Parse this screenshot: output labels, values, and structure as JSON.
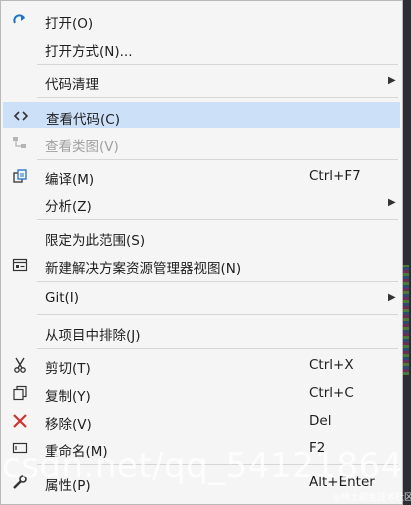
{
  "menu": {
    "items": [
      {
        "label": "打开(O)",
        "icon": "redo-arrow-icon"
      },
      {
        "label": "打开方式(N)..."
      },
      {
        "label": "代码清理",
        "submenu": true
      },
      {
        "label": "查看代码(C)",
        "icon": "code-icon",
        "hover": true
      },
      {
        "label": "查看类图(V)",
        "icon": "class-diagram-icon",
        "disabled": true
      },
      {
        "label": "编译(M)",
        "icon": "compile-icon",
        "shortcut": "Ctrl+F7"
      },
      {
        "label": "分析(Z)",
        "submenu": true
      },
      {
        "label": "限定为此范围(S)"
      },
      {
        "label": "新建解决方案资源管理器视图(N)",
        "icon": "solution-explorer-icon"
      },
      {
        "label": "Git(I)",
        "submenu": true
      },
      {
        "label": "从项目中排除(J)"
      },
      {
        "label": "剪切(T)",
        "icon": "scissors-icon",
        "shortcut": "Ctrl+X"
      },
      {
        "label": "复制(Y)",
        "icon": "copy-icon",
        "shortcut": "Ctrl+C"
      },
      {
        "label": "移除(V)",
        "icon": "remove-x-icon",
        "shortcut": "Del"
      },
      {
        "label": "重命名(M)",
        "icon": "rename-icon",
        "shortcut": "F2"
      },
      {
        "label": "属性(P)",
        "icon": "wrench-icon",
        "shortcut": "Alt+Enter"
      }
    ]
  },
  "colors": {
    "menu_background": "#f5f5f5",
    "hover_highlight": "#cce0f7",
    "disabled_text": "#a0a0a0",
    "remove_red": "#d32f2f",
    "redo_blue": "#1e73c8"
  },
  "watermark": {
    "text": "csdn.net/qq_54121864",
    "small_text": "@稀土掘金技术社区"
  }
}
